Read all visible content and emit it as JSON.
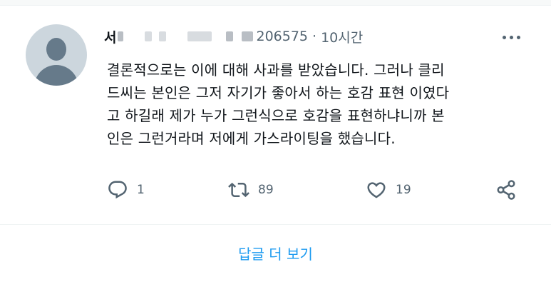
{
  "post": {
    "display_name": "서",
    "handle_suffix": "206575",
    "separator": "·",
    "time": "10시간",
    "text": "결론적으로는 이에 대해 사과를 받았습니다. 그러나 클리\n드씨는 본인은 그저 자기가 좋아서 하는 호감 표현 이였다\n고 하길래 제가 누가 그런식으로 호감을 표현하냐니까 본\n인은 그런거라며 저에게 가스라이팅을 했습니다.",
    "actions": {
      "reply_count": "1",
      "retweet_count": "89",
      "like_count": "19"
    }
  },
  "footer": {
    "show_more_label": "답글 더 보기"
  },
  "colors": {
    "text": "#0f1419",
    "secondary": "#536471",
    "accent": "#1d9bf0",
    "avatar_bg": "#ccd6dd"
  },
  "icons": [
    "reply-icon",
    "retweet-icon",
    "like-icon",
    "share-icon",
    "more-icon",
    "default-avatar"
  ]
}
